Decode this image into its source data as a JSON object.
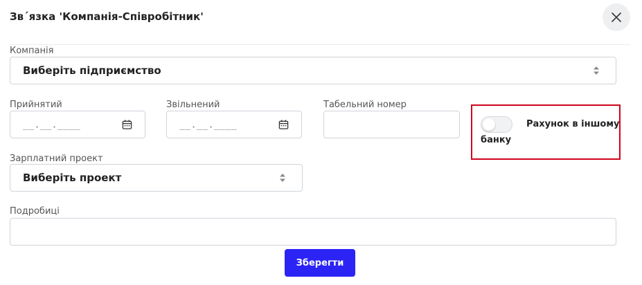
{
  "modal": {
    "title": "Зв´язка 'Компанія-Співробітник'",
    "close_icon": "close-icon"
  },
  "company": {
    "label": "Компанія",
    "value": "Виберіть підприємство"
  },
  "hired": {
    "label": "Прийнятий",
    "value": "__.__.____"
  },
  "fired": {
    "label": "Звільнений",
    "value": "__.__.____"
  },
  "tab_number": {
    "label": "Табельний номер",
    "value": ""
  },
  "other_bank": {
    "label_line1": "Рахунок в іншому",
    "label_line2": "банку",
    "checked": false
  },
  "salary_project": {
    "label": "Зарплатний проект",
    "value": "Виберіть проект"
  },
  "details": {
    "label": "Подробиці",
    "value": ""
  },
  "actions": {
    "save_label": "Зберегти"
  },
  "colors": {
    "primary": "#2b24f5",
    "highlight": "#d0021b",
    "border": "#ced4da"
  }
}
